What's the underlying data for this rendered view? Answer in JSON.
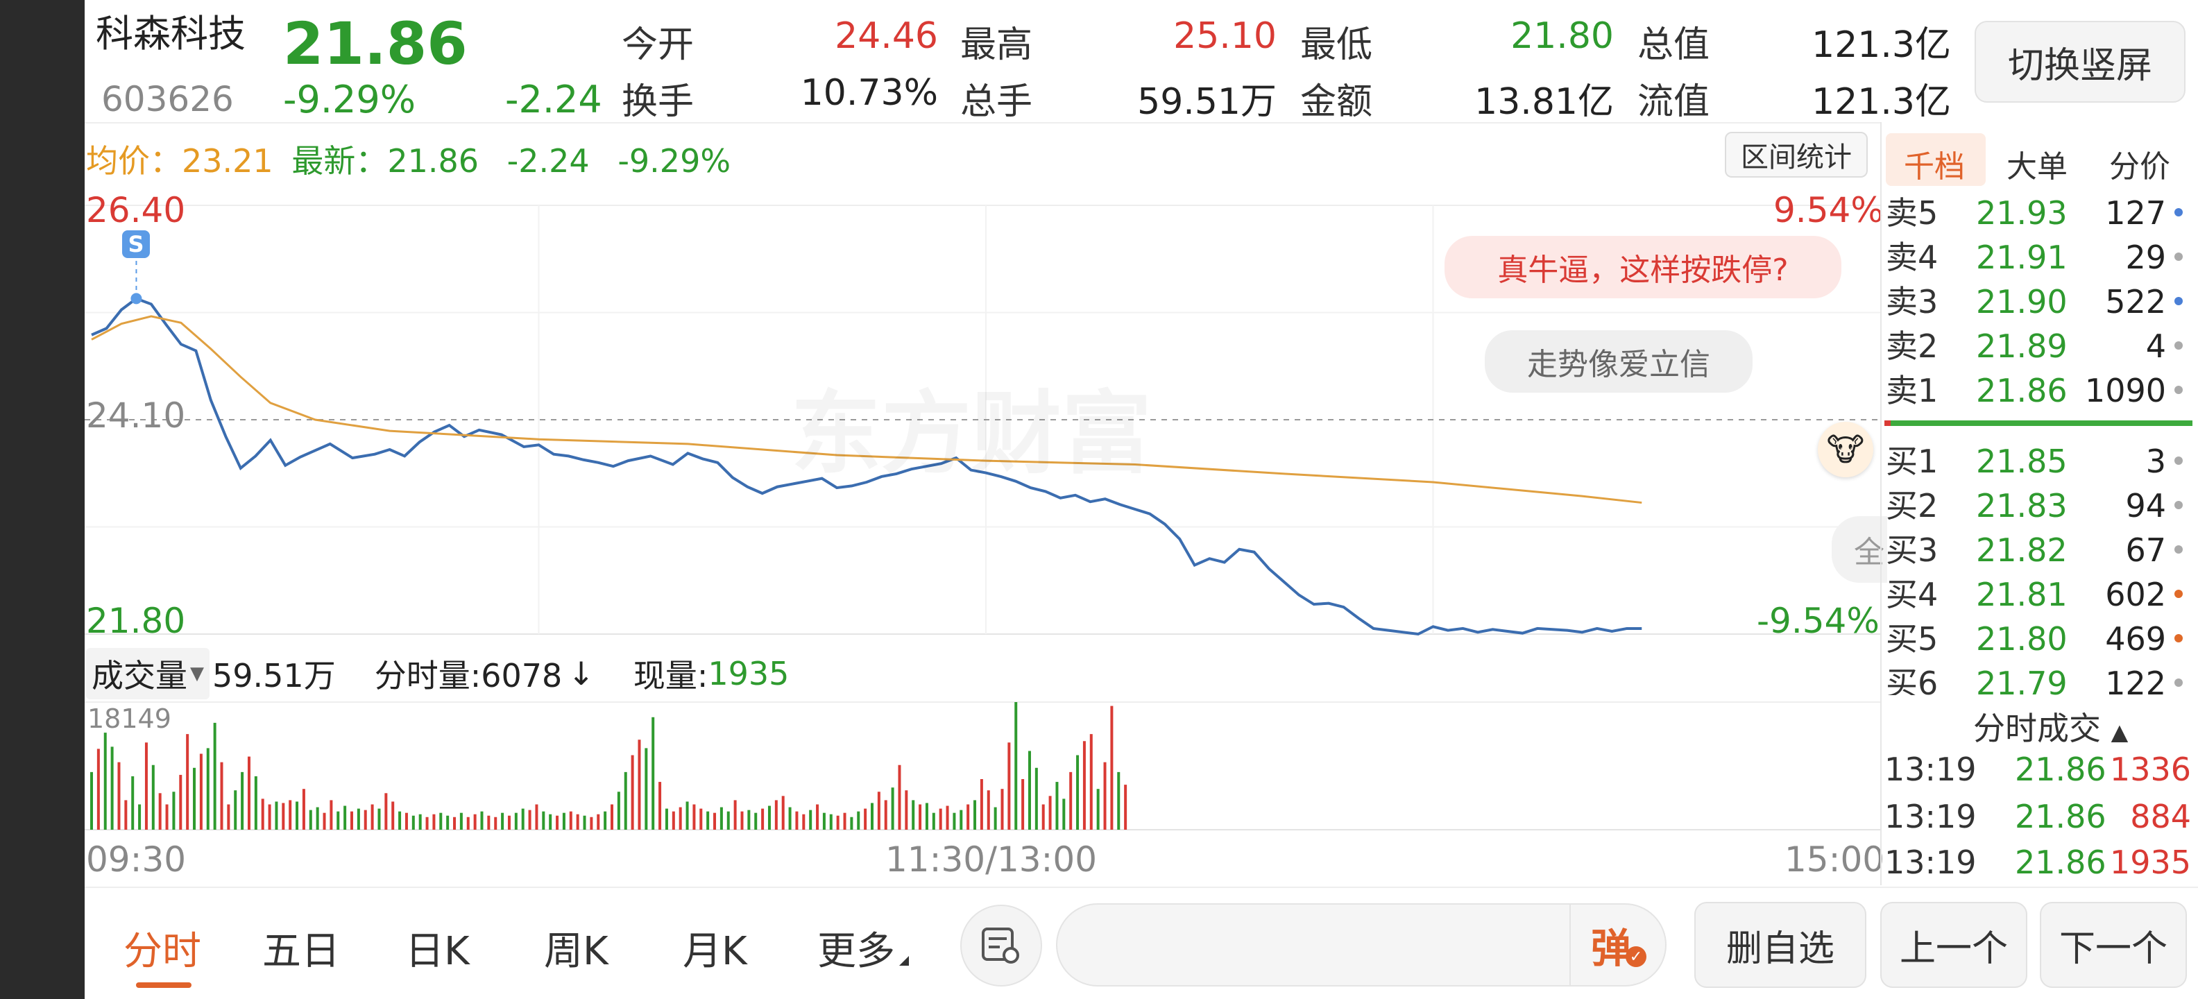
{
  "stock": {
    "name": "科森科技",
    "price": "21.86",
    "code": "603626",
    "change_pct": "-9.29%",
    "change_amt": "-2.24"
  },
  "stats": [
    {
      "label": "今开",
      "value": "24.46",
      "tone": "red"
    },
    {
      "label": "最高",
      "value": "25.10",
      "tone": "red"
    },
    {
      "label": "最低",
      "value": "21.80",
      "tone": "green"
    },
    {
      "label": "总值",
      "value": "121.3亿",
      "tone": "dark"
    },
    {
      "label": "换手",
      "value": "10.73%",
      "tone": "dark"
    },
    {
      "label": "总手",
      "value": "59.51万",
      "tone": "dark"
    },
    {
      "label": "金额",
      "value": "13.81亿",
      "tone": "dark"
    },
    {
      "label": "流值",
      "value": "121.3亿",
      "tone": "dark"
    }
  ],
  "switch_button": "切换竖屏",
  "info_line": {
    "avg_label": "均价：",
    "avg_value": "23.21",
    "latest_label": "最新：",
    "latest_value": "21.86",
    "latest_change": "-2.24",
    "latest_pct": "-9.29%"
  },
  "range_stats_button": "区间统计",
  "chart_labels": {
    "y_top": "26.40",
    "y_mid": "24.10",
    "y_bottom": "21.80",
    "pct_top": "9.54%",
    "pct_bottom": "-9.54%",
    "watermark": "东方财富",
    "marker_letter": "S"
  },
  "comments": [
    "真牛逼，这样按跌停?",
    "走势像爱立信"
  ],
  "collapsed_label": "全",
  "volume_bar": {
    "dropdown_label": "成交量",
    "total": "59.51万",
    "tick_label": "分时量:6078",
    "tick_arrow": "↓",
    "current_label": "现量:",
    "current_value": "1935",
    "max_label": "18149"
  },
  "time_axis": [
    "09:30",
    "11:30/13:00",
    "15:00"
  ],
  "orderbook": {
    "tabs": [
      "千档",
      "大单",
      "分价"
    ],
    "active_tab": 0,
    "asks": [
      {
        "label": "卖5",
        "price": "21.93",
        "vol": "127",
        "dot": "#4a7fd6"
      },
      {
        "label": "卖4",
        "price": "21.91",
        "vol": "29",
        "dot": "#aaaaaa"
      },
      {
        "label": "卖3",
        "price": "21.90",
        "vol": "522",
        "dot": "#4a7fd6"
      },
      {
        "label": "卖2",
        "price": "21.89",
        "vol": "4",
        "dot": "#aaaaaa"
      },
      {
        "label": "卖1",
        "price": "21.86",
        "vol": "1090",
        "dot": "#aaaaaa"
      }
    ],
    "bids": [
      {
        "label": "买1",
        "price": "21.85",
        "vol": "3",
        "dot": "#aaaaaa"
      },
      {
        "label": "买2",
        "price": "21.83",
        "vol": "94",
        "dot": "#aaaaaa"
      },
      {
        "label": "买3",
        "price": "21.82",
        "vol": "67",
        "dot": "#aaaaaa"
      },
      {
        "label": "买4",
        "price": "21.81",
        "vol": "602",
        "dot": "#e06a28"
      },
      {
        "label": "买5",
        "price": "21.80",
        "vol": "469",
        "dot": "#e06a28"
      },
      {
        "label": "买6",
        "price": "21.79",
        "vol": "122",
        "dot": "#aaaaaa"
      }
    ],
    "ask_bid_ratio": 0.02
  },
  "trades": {
    "title": "分时成交",
    "rows": [
      {
        "time": "13:19",
        "price": "21.86",
        "vol": "1336",
        "tone": "red"
      },
      {
        "time": "13:19",
        "price": "21.86",
        "vol": "884",
        "tone": "red"
      },
      {
        "time": "13:19",
        "price": "21.86",
        "vol": "1935",
        "tone": "red"
      }
    ]
  },
  "bottom_tabs": [
    "分时",
    "五日",
    "日K",
    "周K",
    "月K",
    "更多"
  ],
  "active_bottom_tab": 0,
  "danmu_label": "弹",
  "action_buttons": [
    "删自选",
    "上一个",
    "下一个"
  ],
  "colors": {
    "up": "#d93a34",
    "down": "#2e9a2e",
    "price_line": "#3b6db0",
    "avg_line": "#e0a040",
    "accent": "#e0622a"
  },
  "chart_data": {
    "type": "line",
    "title": "",
    "ylim": [
      21.8,
      26.4
    ],
    "prev_close": 24.1,
    "x_ticks": [
      "09:30",
      "11:30/13:00",
      "15:00"
    ],
    "total_minutes": 240,
    "series": [
      {
        "name": "",
        "x": [
          0,
          2,
          4,
          6,
          8,
          10,
          12,
          14,
          16,
          18,
          20,
          22,
          24,
          26,
          28,
          30,
          32,
          35,
          38,
          40,
          42,
          44,
          46,
          48,
          50,
          52,
          55,
          58,
          60,
          62,
          64,
          66,
          68,
          70,
          72,
          75,
          78,
          80,
          82,
          84,
          86,
          88,
          90,
          92,
          94,
          96,
          98,
          100,
          102,
          104,
          106,
          108,
          110,
          112,
          114,
          116,
          118,
          120,
          122,
          124,
          126,
          128,
          130,
          132,
          134,
          136,
          138,
          140,
          142,
          144,
          146,
          148,
          150,
          152,
          154,
          156,
          158,
          160,
          162,
          164,
          166,
          168,
          170,
          172,
          174,
          176,
          178,
          180,
          182,
          184,
          186,
          188,
          190,
          192,
          194,
          196,
          198,
          200,
          202,
          204,
          206,
          208
        ],
        "values": [
          25.01,
          25.08,
          25.28,
          25.4,
          25.34,
          25.12,
          24.91,
          24.84,
          24.31,
          23.92,
          23.58,
          23.71,
          23.88,
          23.61,
          23.7,
          23.77,
          23.84,
          23.69,
          23.73,
          23.78,
          23.71,
          23.86,
          23.97,
          24.04,
          23.92,
          23.99,
          23.94,
          23.81,
          23.83,
          23.73,
          23.71,
          23.67,
          23.64,
          23.6,
          23.66,
          23.71,
          23.62,
          23.74,
          23.68,
          23.64,
          23.48,
          23.38,
          23.31,
          23.38,
          23.41,
          23.44,
          23.47,
          23.37,
          23.39,
          23.43,
          23.49,
          23.52,
          23.57,
          23.6,
          23.63,
          23.69,
          23.56,
          23.53,
          23.49,
          23.44,
          23.37,
          23.33,
          23.26,
          23.29,
          23.22,
          23.25,
          23.19,
          23.14,
          23.09,
          22.98,
          22.82,
          22.54,
          22.61,
          22.57,
          22.71,
          22.68,
          22.5,
          22.36,
          22.22,
          22.12,
          22.13,
          22.09,
          21.97,
          21.86,
          21.84,
          21.82,
          21.8,
          21.88,
          21.84,
          21.86,
          21.82,
          21.85,
          21.83,
          21.81,
          21.86,
          21.85,
          21.84,
          21.82,
          21.86,
          21.83,
          21.86,
          21.86
        ]
      },
      {
        "name": "",
        "x": [
          0,
          4,
          8,
          12,
          16,
          20,
          24,
          30,
          40,
          60,
          80,
          100,
          120,
          140,
          160,
          180,
          200,
          208
        ],
        "values": [
          24.96,
          25.13,
          25.21,
          25.14,
          24.86,
          24.56,
          24.28,
          24.1,
          23.98,
          23.89,
          23.84,
          23.72,
          23.66,
          23.62,
          23.52,
          23.43,
          23.28,
          23.21
        ]
      }
    ],
    "volume": {
      "max": 18149,
      "values": [
        8200,
        11500,
        13800,
        11800,
        9600,
        4200,
        7600,
        3600,
        12400,
        9200,
        5200,
        3600,
        5400,
        7800,
        13600,
        8800,
        10800,
        11600,
        15200,
        9600,
        3600,
        5600,
        8200,
        10400,
        7600,
        4400,
        3600,
        4000,
        3800,
        4200,
        4000,
        5800,
        2800,
        3200,
        2400,
        4200,
        2600,
        3400,
        2600,
        3000,
        2800,
        3600,
        3000,
        5200,
        4000,
        2600,
        2400,
        2000,
        2200,
        1800,
        2200,
        2400,
        2000,
        1800,
        2400,
        1800,
        2200,
        2600,
        2000,
        1800,
        2400,
        2000,
        2400,
        3000,
        2800,
        3600,
        2600,
        2200,
        2000,
        2400,
        2600,
        2200,
        2000,
        1800,
        2200,
        2600,
        3600,
        5400,
        8200,
        10600,
        12800,
        11600,
        16000,
        6800,
        3000,
        2600,
        3200,
        4000,
        3600,
        3000,
        2600,
        2400,
        3200,
        2600,
        4200,
        2600,
        2800,
        2400,
        3000,
        3400,
        4200,
        4800,
        3200,
        2600,
        2200,
        2800,
        3600,
        2400,
        2200,
        2000,
        2400,
        1800,
        2600,
        3000,
        3800,
        5400,
        4200,
        6000,
        9200,
        5600,
        4200,
        3600,
        3800,
        2400,
        3000,
        3400,
        2400,
        2800,
        3600,
        4200,
        7200,
        5600,
        3200,
        5800,
        12400,
        18149,
        7200,
        11200,
        8800,
        3600,
        4800,
        6800,
        4400,
        8200,
        10600,
        12600,
        13600,
        5800,
        9600,
        17600,
        8200,
        6400
      ],
      "colors": "alternating red/green per price move"
    }
  }
}
